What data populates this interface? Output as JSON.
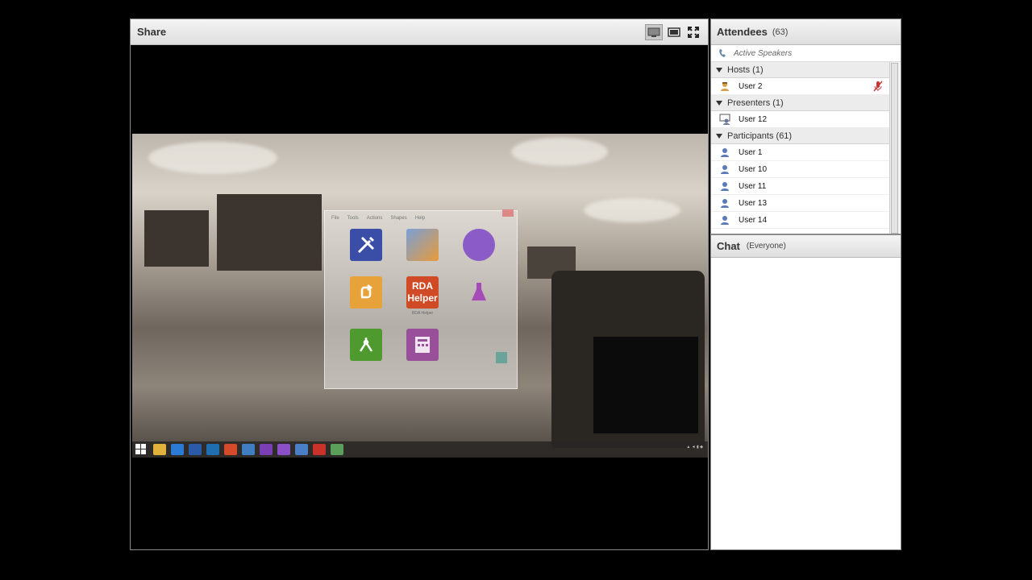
{
  "share": {
    "title": "Share",
    "tools": [
      {
        "icon": "monitor-icon"
      },
      {
        "icon": "fit-screen-icon"
      },
      {
        "icon": "fullscreen-icon"
      }
    ],
    "app_window": {
      "menu": [
        "File",
        "Tools",
        "Actions",
        "Shapes",
        "Help"
      ],
      "tiles": [
        {
          "label": "",
          "icon_text": "",
          "color": "#3a4ea8"
        },
        {
          "label": "",
          "icon_text": "",
          "color": "#7aa0d8"
        },
        {
          "label": "",
          "icon_text": "",
          "color": "#8b5cc7"
        },
        {
          "label": "",
          "icon_text": "",
          "color": "#e8a23a"
        },
        {
          "label": "RDA Helper",
          "icon_text": "RDA\nHelper",
          "color": "#d04a25"
        },
        {
          "label": "",
          "icon_text": "",
          "color": "#a64ab8"
        },
        {
          "label": "",
          "icon_text": "",
          "color": "#4f9a2f"
        },
        {
          "label": "",
          "icon_text": "",
          "color": "#9a4f9a"
        },
        {
          "label": "",
          "icon_text": "",
          "color": "transparent"
        }
      ]
    },
    "taskbar_icons": [
      "#4aa3df",
      "#e2b13c",
      "#2b7bd6",
      "#2a5aa8",
      "#1f6fb0",
      "#d44a2a",
      "#3f7fc1",
      "#7a3fb5",
      "#8b4fc8",
      "#4a7fc8",
      "#c9322b",
      "#5aa05a"
    ]
  },
  "attendees": {
    "title": "Attendees",
    "count": "(63)",
    "active_speakers": "Active Speakers",
    "groups": [
      {
        "label": "Hosts (1)",
        "users": [
          {
            "name": "User 2",
            "role": "host"
          }
        ]
      },
      {
        "label": "Presenters (1)",
        "users": [
          {
            "name": "User 12",
            "role": "presenter"
          }
        ]
      },
      {
        "label": "Participants (61)",
        "users": [
          {
            "name": "User 1",
            "role": "participant"
          },
          {
            "name": "User 10",
            "role": "participant"
          },
          {
            "name": "User 11",
            "role": "participant"
          },
          {
            "name": "User 13",
            "role": "participant"
          },
          {
            "name": "User 14",
            "role": "participant"
          }
        ]
      }
    ]
  },
  "chat": {
    "title": "Chat",
    "scope": "(Everyone)"
  }
}
